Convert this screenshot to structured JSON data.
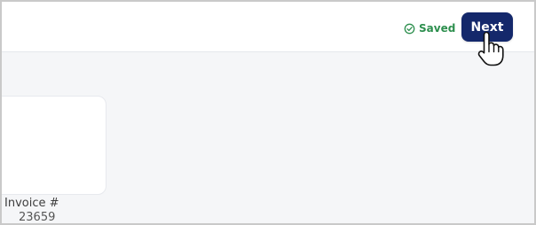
{
  "header": {
    "status_icon": "check-circle-icon",
    "status_text": "Saved",
    "next_label": "Next"
  },
  "invoice": {
    "label": "Invoice #",
    "number": "23659"
  },
  "colors": {
    "primary_button": "#14286b",
    "saved_green": "#2d8f4e",
    "page_background": "#f5f6f8"
  }
}
